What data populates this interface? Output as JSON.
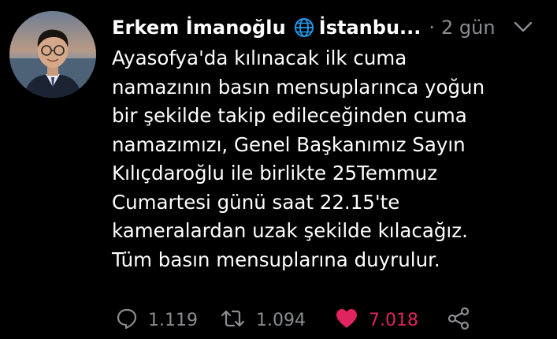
{
  "tweet": {
    "author": {
      "display_name": "Erkem İmanoğlu",
      "location_icon": "globe-icon",
      "location": "İstanbu...",
      "avatar_icon": "profile-photo"
    },
    "separator": "·",
    "time": "2 gün",
    "menu_icon": "chevron-down-icon",
    "lines": [
      "Ayasofya'da kılınacak ilk cuma",
      "namazının basın mensuplarınca yoğun",
      "bir şekilde takip edileceğinden cuma",
      "namazımızı, Genel Başkanımız Sayın",
      "Kılıçdaroğlu ile birlikte 25Temmuz",
      "Cumartesi günü saat 22.15'te",
      "kameralardan uzak şekilde kılacağız.",
      "Tüm basın mensuplarına duyrulur."
    ],
    "actions": {
      "reply_count": "1.119",
      "retweet_count": "1.094",
      "like_count": "7.018",
      "share_icon": "share-icon"
    },
    "colors": {
      "background": "#000000",
      "text": "#ffffff",
      "muted": "#8a8d91",
      "like": "#e0245e",
      "globe": "#1d9bf0"
    }
  }
}
